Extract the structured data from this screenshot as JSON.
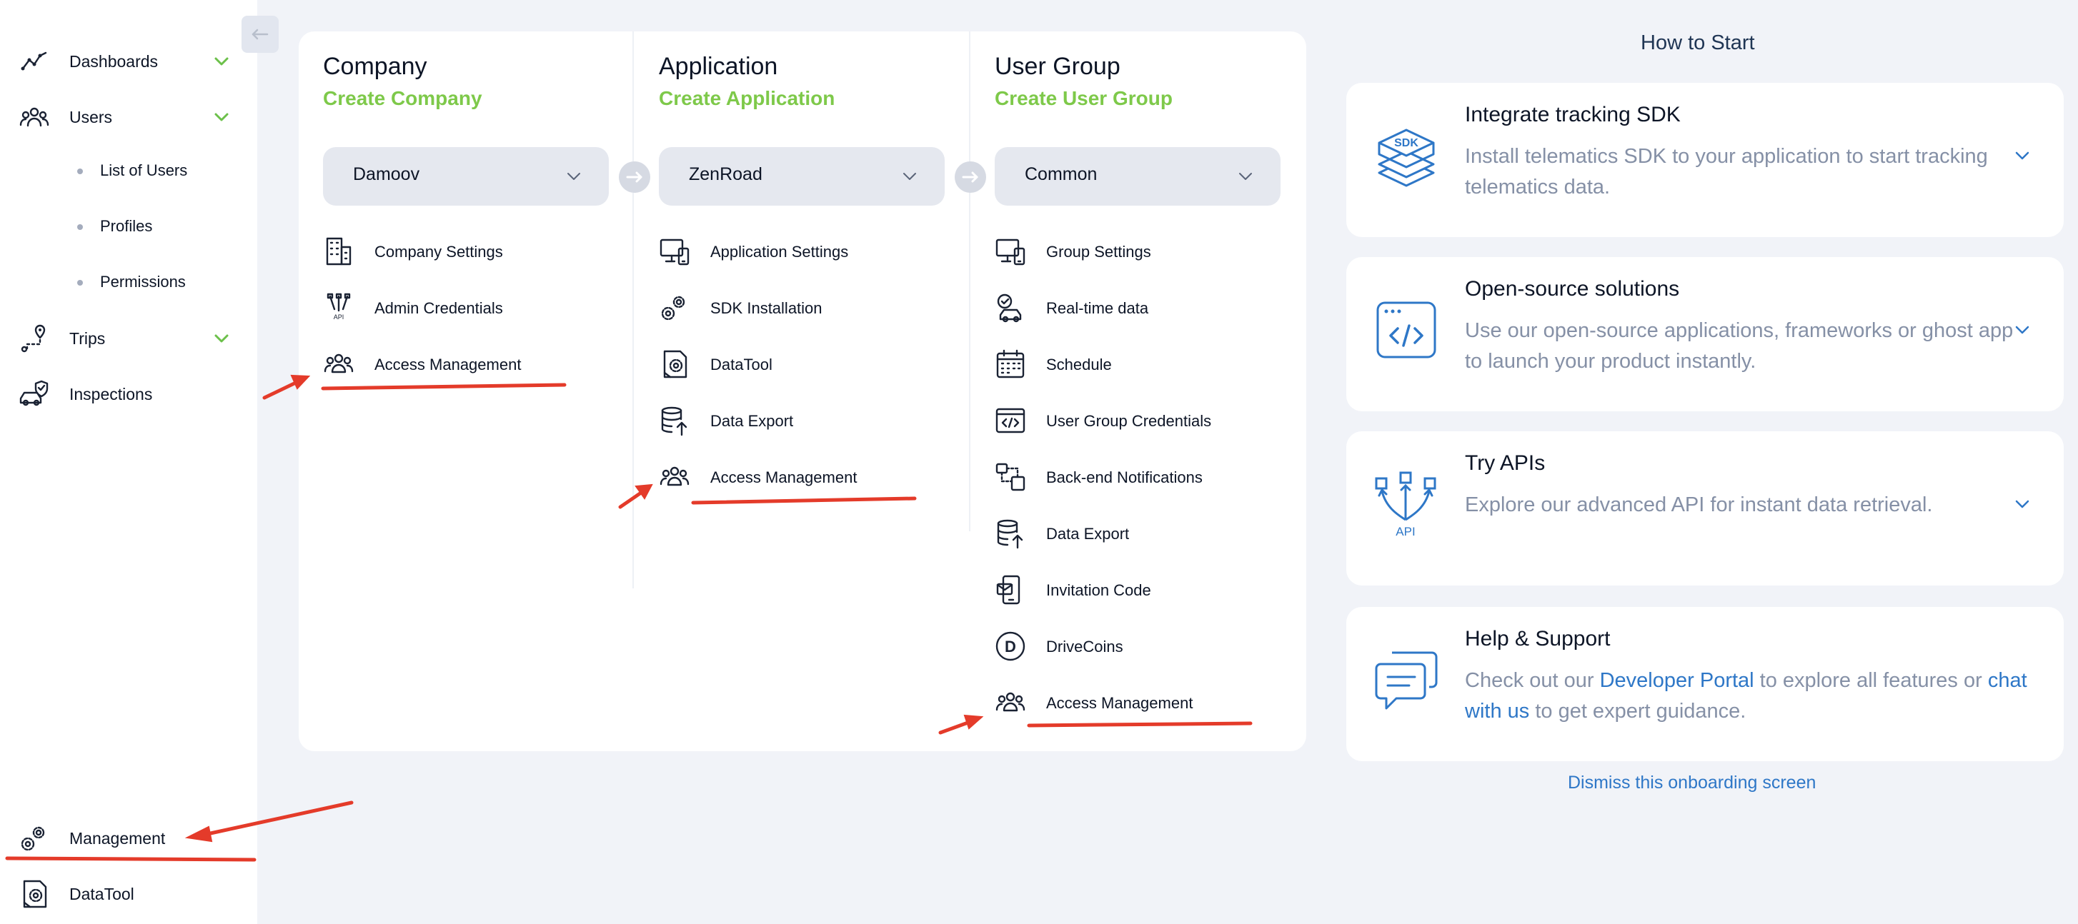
{
  "sidebar": {
    "items": [
      {
        "label": "Dashboards",
        "icon": "trend-line-icon",
        "expandable": true
      },
      {
        "label": "Users",
        "icon": "users-group-icon",
        "expandable": true
      },
      {
        "label": "Trips",
        "icon": "route-pin-icon",
        "expandable": true
      },
      {
        "label": "Inspections",
        "icon": "car-shield-icon",
        "expandable": false
      }
    ],
    "users_sub": [
      "List of Users",
      "Profiles",
      "Permissions"
    ],
    "bottom": [
      {
        "label": "Management",
        "icon": "gears-icon"
      },
      {
        "label": "DataTool",
        "icon": "datatool-icon"
      }
    ],
    "chevron_color": "#6cc04a"
  },
  "columns": [
    {
      "title": "Company",
      "create_label": "Create Company",
      "selected": "Damoov",
      "items": [
        {
          "label": "Company Settings",
          "icon": "building-icon"
        },
        {
          "label": "Admin Credentials",
          "icon": "api-key-icon"
        },
        {
          "label": "Access Management",
          "icon": "people-icon"
        }
      ]
    },
    {
      "title": "Application",
      "create_label": "Create Application",
      "selected": "ZenRoad",
      "items": [
        {
          "label": "Application Settings",
          "icon": "monitor-phone-icon"
        },
        {
          "label": "SDK Installation",
          "icon": "gears-icon"
        },
        {
          "label": "DataTool",
          "icon": "datatool-icon"
        },
        {
          "label": "Data Export",
          "icon": "database-export-icon"
        },
        {
          "label": "Access Management",
          "icon": "people-icon"
        }
      ]
    },
    {
      "title": "User Group",
      "create_label": "Create User Group",
      "selected": "Common",
      "items": [
        {
          "label": "Group Settings",
          "icon": "monitor-phone-icon"
        },
        {
          "label": "Real-time data",
          "icon": "car-signal-icon"
        },
        {
          "label": "Schedule",
          "icon": "calendar-icon"
        },
        {
          "label": "User Group Credentials",
          "icon": "code-window-icon"
        },
        {
          "label": "Back-end Notifications",
          "icon": "notification-flow-icon"
        },
        {
          "label": "Data Export",
          "icon": "database-export-icon"
        },
        {
          "label": "Invitation Code",
          "icon": "invite-phone-icon"
        },
        {
          "label": "DriveCoins",
          "icon": "drivecoin-icon"
        },
        {
          "label": "Access Management",
          "icon": "people-icon"
        }
      ]
    }
  ],
  "how_to_start": {
    "title": "How to Start",
    "cards": [
      {
        "title": "Integrate tracking SDK",
        "desc": "Install telematics SDK to your application to start tracking telematics data.",
        "icon": "sdk-layers-icon",
        "icon_text": "SDK"
      },
      {
        "title": "Open-source solutions",
        "desc": "Use our open-source applications, frameworks or ghost app to launch your product instantly.",
        "icon": "code-browser-icon"
      },
      {
        "title": "Try APIs",
        "desc": "Explore our advanced API for instant data retrieval.",
        "icon": "api-nodes-icon",
        "icon_text": "API"
      },
      {
        "title": "Help & Support",
        "desc_parts": [
          "Check out our ",
          "Developer Portal",
          " to explore all features or ",
          "chat with us",
          " to get expert guidance."
        ],
        "icon": "chat-bubbles-icon"
      }
    ],
    "dismiss": "Dismiss this onboarding screen"
  },
  "colors": {
    "accent_green": "#7ec94a",
    "link_blue": "#2e77c7",
    "icon_blue": "#2e77c7",
    "annotation_red": "#e43b2a",
    "background": "#f1f3f8"
  }
}
